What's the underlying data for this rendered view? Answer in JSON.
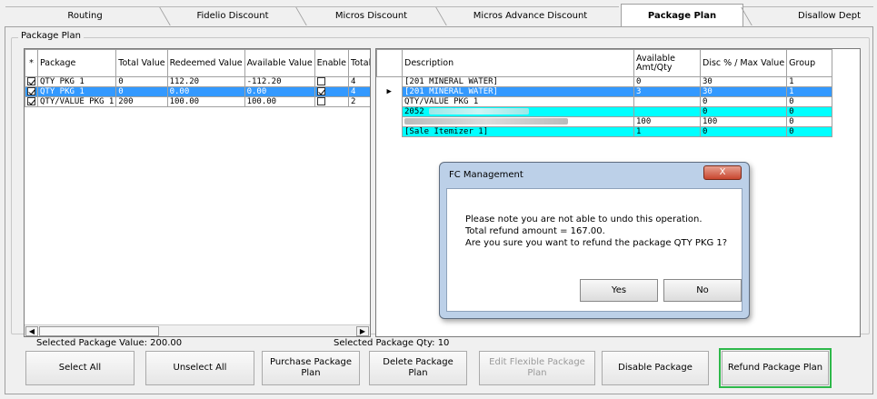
{
  "tabs": [
    {
      "label": "Routing"
    },
    {
      "label": "Fidelio Discount"
    },
    {
      "label": "Micros Discount"
    },
    {
      "label": "Micros Advance Discount"
    },
    {
      "label": "Package Plan"
    },
    {
      "label": "Disallow Dept"
    }
  ],
  "group_title": "Package Plan",
  "left_grid": {
    "columns": [
      "*",
      "Package",
      "Total Value",
      "Redeemed Value",
      "Available Value",
      "Enable",
      "Total Qt"
    ],
    "rows": [
      {
        "checked": true,
        "package": "QTY PKG 1",
        "total": "0",
        "redeemed": "112.20",
        "available": "-112.20",
        "enable": false,
        "qty": "4",
        "selected": false
      },
      {
        "checked": true,
        "package": "QTY PKG 1",
        "total": "0",
        "redeemed": "0.00",
        "available": "0.00",
        "enable": true,
        "qty": "4",
        "selected": true
      },
      {
        "checked": true,
        "package": "QTY/VALUE PKG 1",
        "total": "200",
        "redeemed": "100.00",
        "available": "100.00",
        "enable": false,
        "qty": "2",
        "selected": false
      }
    ]
  },
  "right_grid": {
    "columns": [
      "Description",
      "Available Amt/Qty",
      "Disc % / Max Value",
      "Group"
    ],
    "rows": [
      {
        "desc": "[201 MINERAL WATER]",
        "avail": "0",
        "disc": "30",
        "group": "1",
        "style": "normal",
        "pointer": false
      },
      {
        "desc": "[201 MINERAL WATER]",
        "avail": "3",
        "disc": "30",
        "group": "1",
        "style": "selected",
        "pointer": true
      },
      {
        "desc": "QTY/VALUE PKG 1",
        "avail": "",
        "disc": "0",
        "group": "0",
        "style": "normal",
        "pointer": false
      },
      {
        "desc": "2052",
        "avail": "",
        "disc": "0",
        "group": "0",
        "style": "cyan",
        "pointer": false,
        "blurred": true
      },
      {
        "desc": "",
        "avail": "100",
        "disc": "100",
        "group": "0",
        "style": "normal",
        "pointer": false,
        "blurred": true
      },
      {
        "desc": "[Sale Itemizer 1]",
        "avail": "1",
        "disc": "0",
        "group": "0",
        "style": "cyan",
        "pointer": false
      }
    ]
  },
  "status": {
    "selected_value": "Selected Package Value: 200.00",
    "selected_qty": "Selected Package Qty: 10"
  },
  "buttons": {
    "select_all": "Select All",
    "unselect_all": "Unselect All",
    "purchase": "Purchase Package Plan",
    "delete": "Delete Package Plan",
    "edit_flexible": "Edit Flexible Package Plan",
    "disable": "Disable Package",
    "refund": "Refund Package Plan"
  },
  "dialog": {
    "title": "FC Management",
    "close": "X",
    "line1": "Please note you are not able to undo this operation.",
    "line2": "Total refund amount = 167.00.",
    "line3": "Are you sure you want to refund the package QTY PKG 1?",
    "yes": "Yes",
    "no": "No"
  },
  "colors": {
    "selected": "#3399ff",
    "cyan": "#00ffff",
    "highlight": "#2db84a"
  }
}
